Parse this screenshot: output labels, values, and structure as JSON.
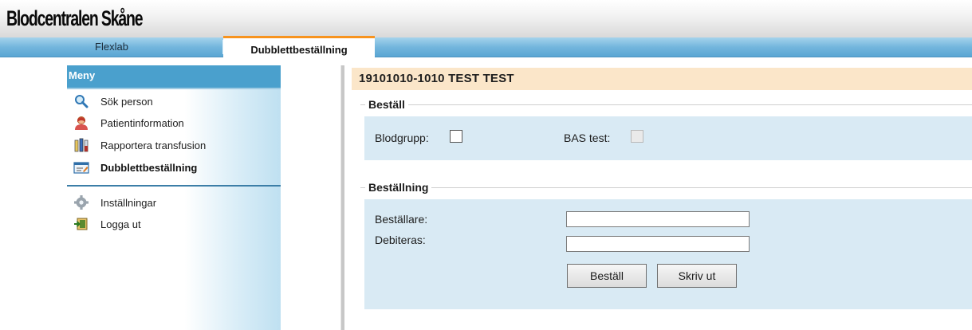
{
  "app": {
    "title": "Blodcentralen Skåne"
  },
  "tabs": [
    {
      "label": "Flexlab",
      "active": false
    },
    {
      "label": "Dubblettbeställning",
      "active": true
    }
  ],
  "sidebar": {
    "heading": "Meny",
    "items": [
      {
        "label": "Sök person",
        "icon": "magnifier-icon"
      },
      {
        "label": "Patientinformation",
        "icon": "person-icon"
      },
      {
        "label": "Rapportera transfusion",
        "icon": "blood-tubes-icon"
      },
      {
        "label": "Dubblettbeställning",
        "icon": "order-form-icon",
        "active": true
      },
      {
        "label": "Inställningar",
        "icon": "gear-icon"
      },
      {
        "label": "Logga ut",
        "icon": "logout-icon"
      }
    ]
  },
  "patient": {
    "header": "19101010-1010  TEST TEST"
  },
  "order_group": {
    "legend": "Beställ",
    "blodgrupp_label": "Blodgrupp:",
    "blodgrupp_checked": false,
    "bas_label": "BAS test:",
    "bas_checked": false,
    "bas_enabled": false
  },
  "order_details": {
    "legend": "Beställning",
    "bestallare_label": "Beställare:",
    "bestallare_value": "",
    "debiteras_label": "Debiteras:",
    "debiteras_value": "",
    "order_button": "Beställ",
    "print_button": "Skriv ut"
  },
  "colors": {
    "menu_header": "#4aa0cd",
    "active_tab_accent": "#f7931e",
    "patient_bar": "#fbe6c9",
    "panel": "#d9eaf4"
  }
}
